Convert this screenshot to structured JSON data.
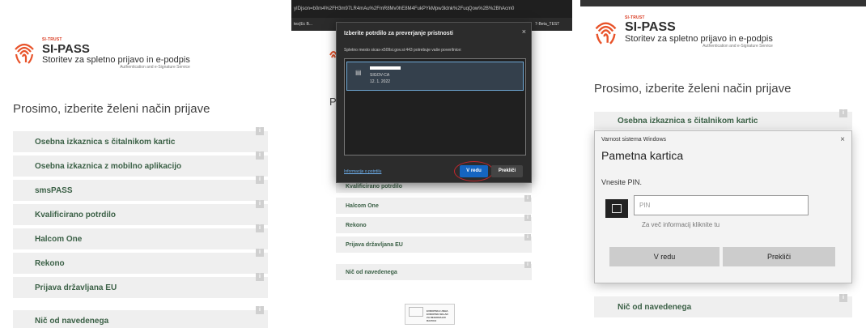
{
  "colors": {
    "accent_orange": "#e8532a",
    "item_text": "#3b6046",
    "item_bg": "#efefef",
    "dialog_bg": "#2c2c2c",
    "primary_blue": "#1565c0"
  },
  "brand": {
    "small": "SI-TRUST",
    "name": "SI-PASS",
    "tagline": "Storitev za spletno prijavo in e-podpis",
    "tagline_en": "Authentication and e-Signature Service"
  },
  "heading": "Prosimo, izberite želeni način prijave",
  "info_glyph": "i",
  "panel1": {
    "items": [
      "Osebna izkaznica s čitalnikom kartic",
      "Osebna izkaznica z mobilno aplikacijo",
      "smsPASS",
      "Kvalificirano potrdilo",
      "Halcom One",
      "Rekono",
      "Prijava državljana EU"
    ],
    "other": "Nič od navedenega"
  },
  "panel2": {
    "url": "yIDjson=b0m4%2FH3m97LR4mAu%2FmR8Mv0hE8M4FukPYkMpw3ldnk%2FuqQow%2B%2BhAcm0",
    "bookmarks": [
      "tes(Ec B...",
      "7-Beta_TEST"
    ],
    "heading_partial": "P",
    "dialog": {
      "title": "Izberite potrdilo za preverjanje pristnosti",
      "close": "×",
      "description": "Spletno mesto sicas-x509si.gov.si:443 potrebuje vaše poverilnice:",
      "certificate": {
        "issuer": "SIGOV-CA",
        "date": "12. 1. 2022"
      },
      "link": "Informacije o potrdilu",
      "ok": "V redu",
      "cancel": "Prekliči"
    },
    "items_partial": [
      "Kvalificirano potrdilo",
      "Halcom One",
      "Rekono",
      "Prijava državljana EU"
    ],
    "other": "Nič od navedenega",
    "eu_logo_text": [
      "EVROPSKA UNIJA",
      "EVROPSKI SKLAD",
      "ZA REGIONALNI RAZVOJ"
    ]
  },
  "panel3": {
    "heading": "Prosimo, izberite želeni način prijave",
    "item": "Osebna izkaznica s čitalnikom kartic",
    "dialog": {
      "title": "Varnost sistema Windows",
      "close": "×",
      "heading": "Pametna kartica",
      "prompt": "Vnesite PIN.",
      "pin_placeholder": "PIN",
      "more_info": "Za več informacij kliknite tu",
      "ok": "V redu",
      "cancel": "Prekliči"
    },
    "other": "Nič od navedenega"
  }
}
